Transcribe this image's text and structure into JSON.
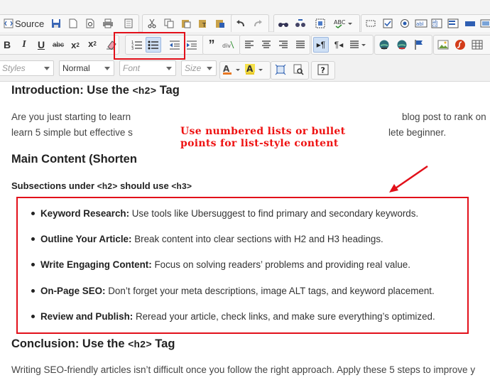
{
  "toolbar": {
    "source_label": "Source",
    "styles_placeholder": "Styles",
    "format_value": "Normal",
    "font_placeholder": "Font",
    "size_placeholder": "Size"
  },
  "content": {
    "intro_heading_pre": "Introduction: Use the ",
    "intro_heading_code": "<h2>",
    "intro_heading_post": " Tag",
    "intro_p1_a": "Are you just starting to learn",
    "intro_p1_b": "blog post to rank on",
    "intro_p2_a": "learn 5 simple but effective s",
    "intro_p2_b": "lete beginner.",
    "main_heading": "Main Content (Shorten",
    "sub_heading_pre": "Subsections under ",
    "sub_heading_code1": "<h2>",
    "sub_heading_mid": " should use ",
    "sub_heading_code2": "<h3>",
    "list": [
      {
        "term": "Keyword Research:",
        "text": " Use tools like Ubersuggest to find primary and secondary keywords."
      },
      {
        "term": "Outline Your Article:",
        "text": " Break content into clear sections with H2 and H3 headings."
      },
      {
        "term": "Write Engaging Content:",
        "text": " Focus on solving readers’ problems and providing real value."
      },
      {
        "term": "On-Page SEO:",
        "text": " Don’t forget your meta descriptions, image ALT tags, and keyword placement."
      },
      {
        "term": "Review and Publish:",
        "text": " Reread your article, check links, and make sure everything’s optimized."
      }
    ],
    "conclusion_heading_pre": "Conclusion: Use the ",
    "conclusion_heading_code": "<h2>",
    "conclusion_heading_post": " Tag",
    "conclusion_p": "Writing SEO-friendly articles isn’t difficult once you follow the right approach. Apply these 5 steps to improve y"
  },
  "annotation": {
    "line1": "Use numbered lists or bullet",
    "line2": "points for list-style content",
    "color": "#ee1111"
  },
  "colors": {
    "highlight_box": "#e2101a",
    "toolbar_bg": "#f3f3f3"
  }
}
